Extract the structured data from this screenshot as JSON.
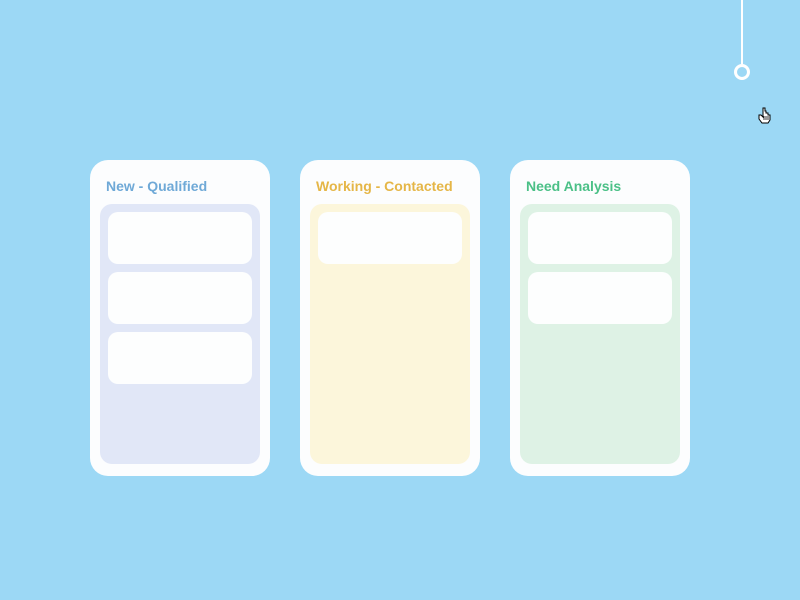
{
  "columns": [
    {
      "title": "New - Qualified",
      "cardCount": 3
    },
    {
      "title": "Working - Contacted",
      "cardCount": 1
    },
    {
      "title": "Need Analysis",
      "cardCount": 2
    }
  ]
}
